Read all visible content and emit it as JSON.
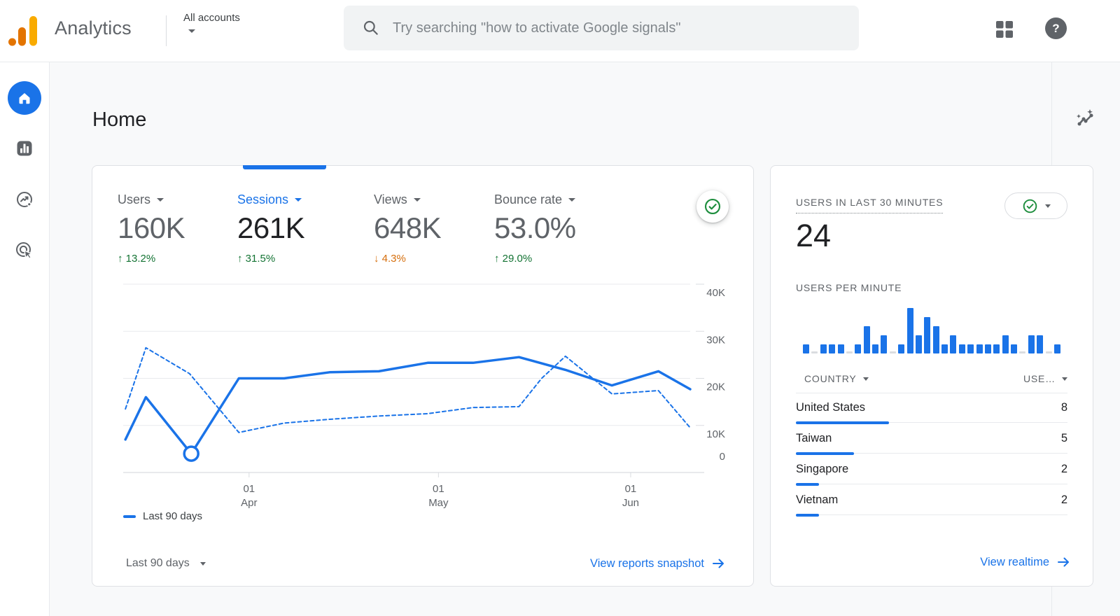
{
  "header": {
    "app_name": "Analytics",
    "account_selector": "All accounts",
    "search_placeholder": "Try searching \"how to activate Google signals\"",
    "icons": {
      "logo": "google-analytics-bars",
      "search": "magnifier",
      "apps": "grid-4-squares",
      "help": "question-mark-circle"
    }
  },
  "sidebar": {
    "items": [
      {
        "name": "home",
        "icon": "home-icon",
        "active": true
      },
      {
        "name": "reports",
        "icon": "bar-chart-icon",
        "active": false
      },
      {
        "name": "explore",
        "icon": "explore-compass-icon",
        "active": false
      },
      {
        "name": "advertising",
        "icon": "target-cursor-icon",
        "active": false
      }
    ]
  },
  "main": {
    "page_title": "Home",
    "insights_icon": "sparkline-stars",
    "overview_card": {
      "metrics": [
        {
          "label": "Users",
          "value": "160K",
          "delta": "13.2%",
          "direction": "up",
          "selected": false
        },
        {
          "label": "Sessions",
          "value": "261K",
          "delta": "31.5%",
          "direction": "up",
          "selected": true
        },
        {
          "label": "Views",
          "value": "648K",
          "delta": "4.3%",
          "direction": "down",
          "selected": false
        },
        {
          "label": "Bounce rate",
          "value": "53.0%",
          "delta": "29.0%",
          "direction": "up",
          "selected": false
        }
      ],
      "status_icon": "check-circle",
      "legend_label": "Last 90 days",
      "date_range_label": "Last 90 days",
      "footer_link": "View reports snapshot"
    },
    "realtime_card": {
      "title": "USERS IN LAST 30 MINUTES",
      "users_count": "24",
      "status_icon": "check-circle",
      "per_minute_title": "USERS PER MINUTE",
      "table": {
        "country_header": "COUNTRY",
        "users_header": "USE…",
        "rows": [
          {
            "country": "United States",
            "users": 8
          },
          {
            "country": "Taiwan",
            "users": 5
          },
          {
            "country": "Singapore",
            "users": 2
          },
          {
            "country": "Vietnam",
            "users": 2
          }
        ]
      },
      "footer_link": "View realtime"
    }
  },
  "colors": {
    "accent": "#1a73e8",
    "positive": "#137333",
    "negative": "#d56e0c",
    "text_primary": "#202124",
    "text_secondary": "#5f6368",
    "logo_orange": "#e37400",
    "logo_amber": "#f9ab00",
    "status_green": "#1e8e3e"
  },
  "chart_data": [
    {
      "type": "line",
      "title": "Sessions, last 90 days vs preceding period",
      "unit": "sessions",
      "ylim": [
        0,
        40000
      ],
      "grid": true,
      "legend_position": "bottom-left",
      "y_ticks": [
        {
          "v": 0,
          "label": "0"
        },
        {
          "v": 10000,
          "label": "10K"
        },
        {
          "v": 20000,
          "label": "20K"
        },
        {
          "v": 30000,
          "label": "30K"
        },
        {
          "v": 40000,
          "label": "40K"
        }
      ],
      "x_ticks": [
        {
          "pos": 0.222,
          "label": [
            "01",
            "Apr"
          ]
        },
        {
          "pos": 0.556,
          "label": [
            "01",
            "May"
          ]
        },
        {
          "pos": 0.895,
          "label": [
            "01",
            "Jun"
          ]
        }
      ],
      "legend": [
        {
          "name": "Last 90 days",
          "style": "solid"
        }
      ],
      "series": [
        {
          "name": "Last 90 days",
          "style": "solid",
          "marker_index": 2,
          "points": [
            [
              0.004,
              7000
            ],
            [
              0.04,
              16000
            ],
            [
              0.12,
              4000
            ],
            [
              0.204,
              20000
            ],
            [
              0.284,
              20000
            ],
            [
              0.364,
              21300
            ],
            [
              0.451,
              21500
            ],
            [
              0.537,
              23300
            ],
            [
              0.617,
              23300
            ],
            [
              0.698,
              24500
            ],
            [
              0.78,
              21800
            ],
            [
              0.862,
              18500
            ],
            [
              0.944,
              21500
            ],
            [
              1,
              17700
            ]
          ]
        },
        {
          "style": "dashed",
          "points": [
            [
              0.004,
              13500
            ],
            [
              0.04,
              26500
            ],
            [
              0.117,
              21000
            ],
            [
              0.204,
              8500
            ],
            [
              0.284,
              10500
            ],
            [
              0.364,
              11300
            ],
            [
              0.451,
              12000
            ],
            [
              0.537,
              12500
            ],
            [
              0.617,
              13800
            ],
            [
              0.698,
              14000
            ],
            [
              0.738,
              20000
            ],
            [
              0.78,
              24700
            ],
            [
              0.862,
              16700
            ],
            [
              0.944,
              17400
            ],
            [
              1,
              9500
            ]
          ]
        }
      ]
    },
    {
      "type": "bar",
      "title": "USERS PER MINUTE",
      "ylabel": "users",
      "values": [
        1,
        0,
        1,
        1,
        1,
        0,
        1,
        3,
        1,
        2,
        0,
        1,
        5,
        2,
        4,
        3,
        1,
        2,
        1,
        1,
        1,
        1,
        1,
        2,
        1,
        0,
        2,
        2,
        0,
        1
      ]
    }
  ]
}
